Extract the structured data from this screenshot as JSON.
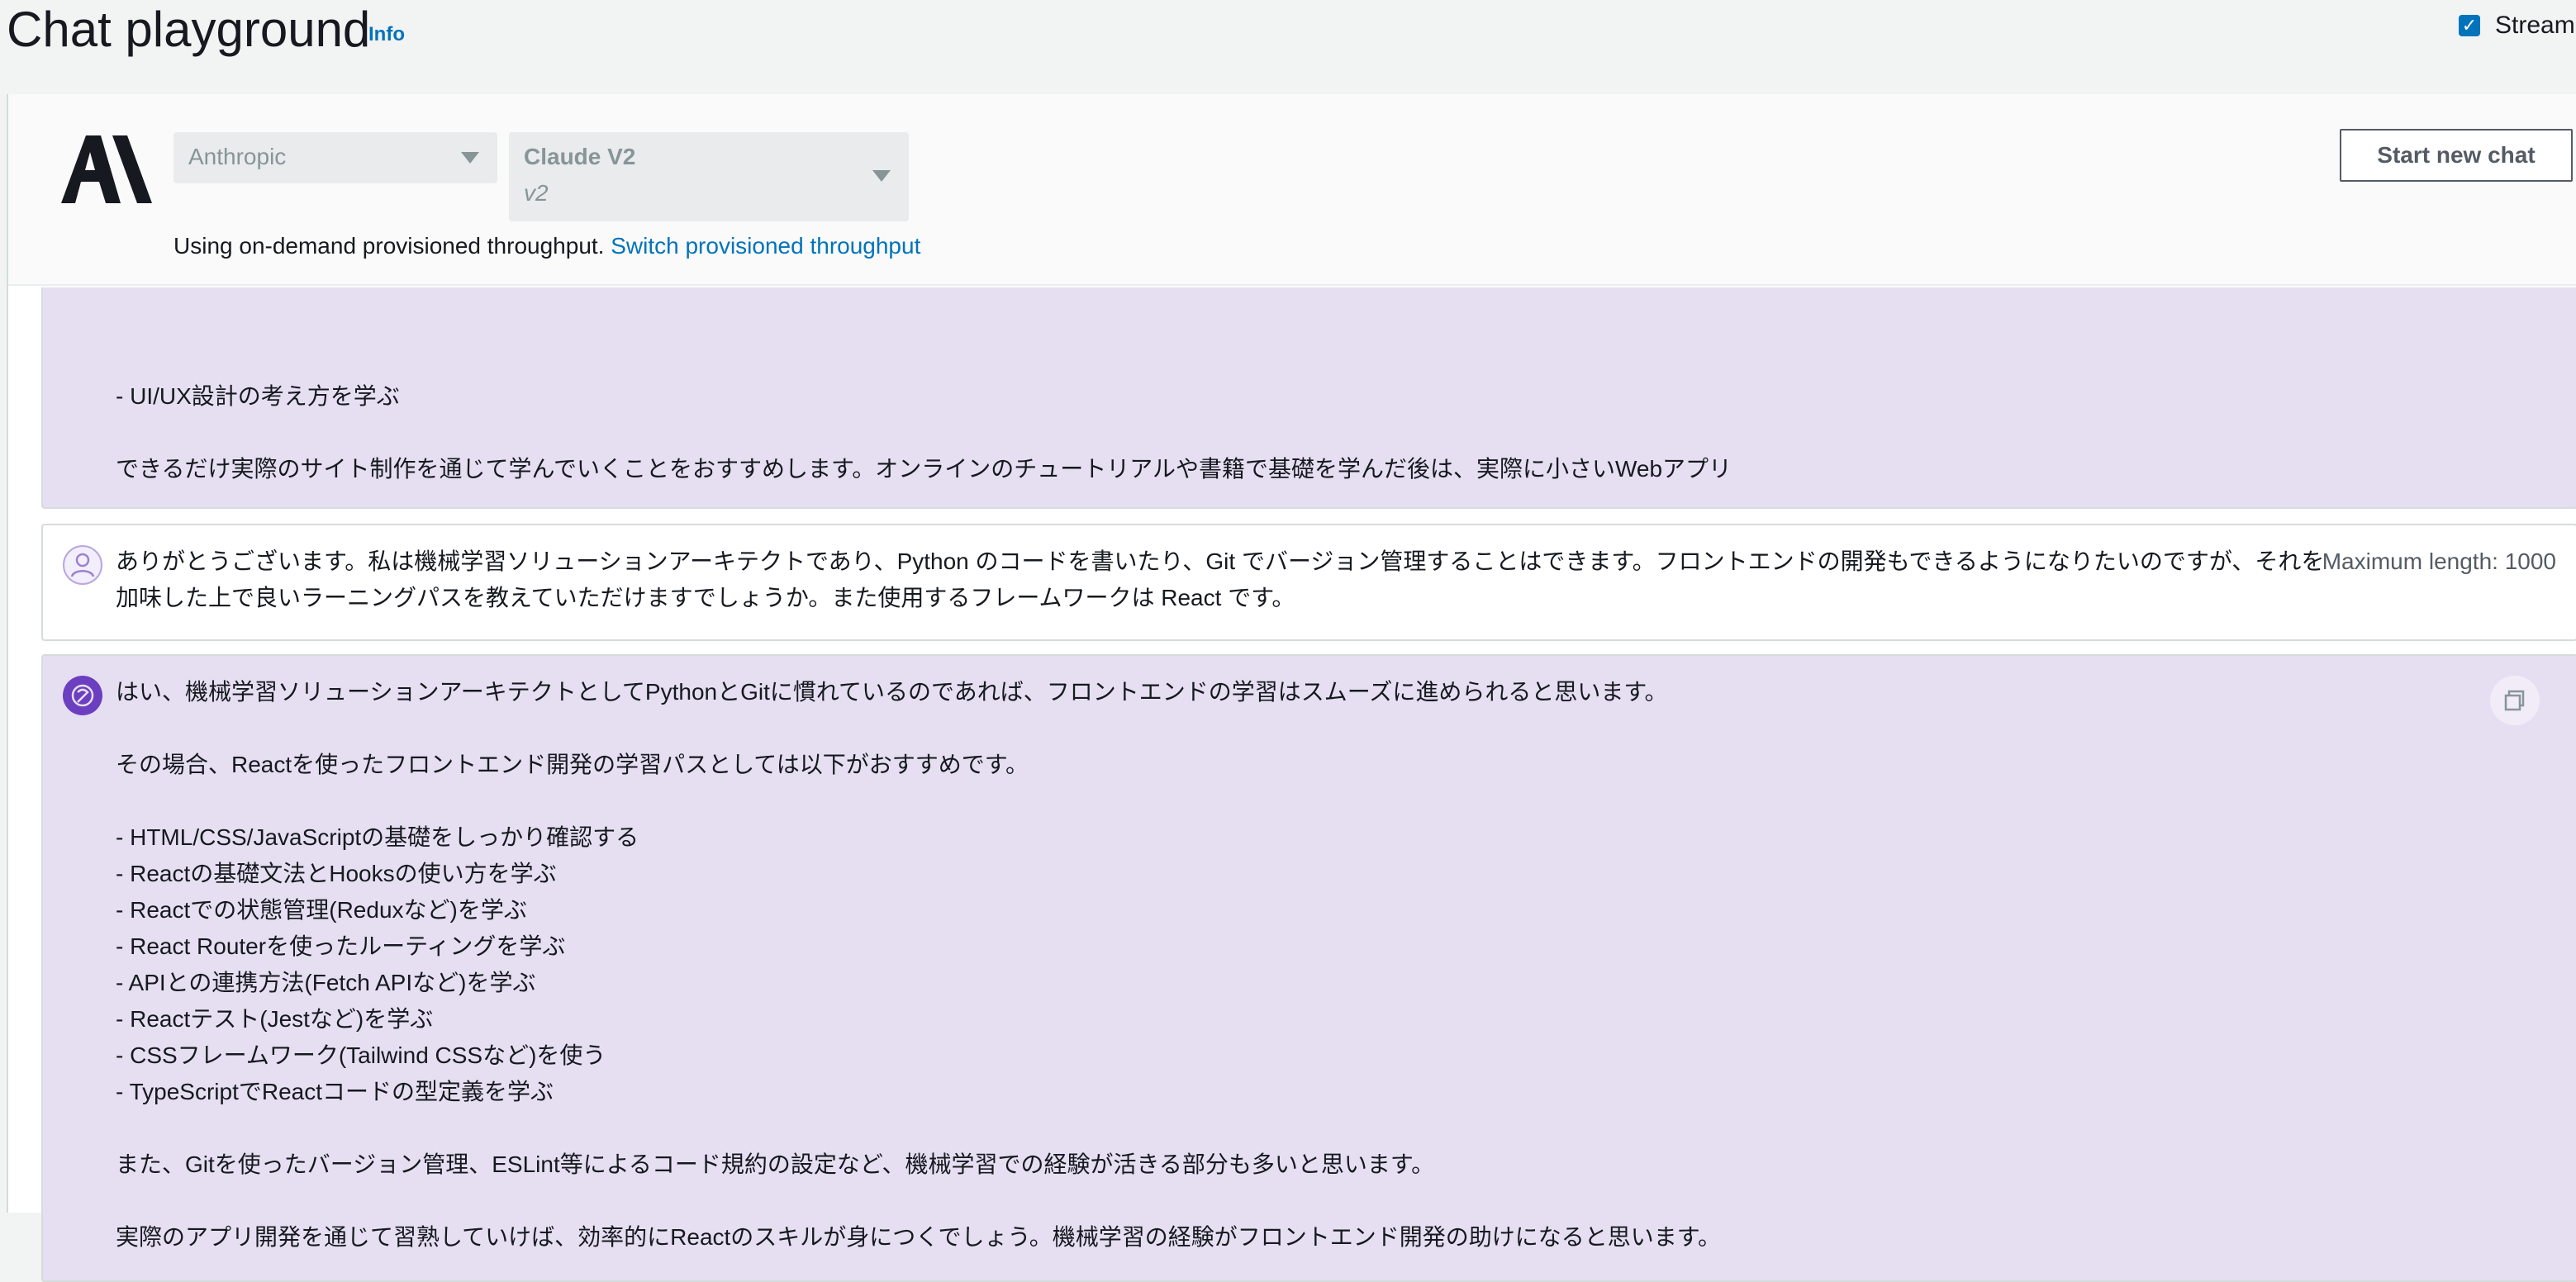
{
  "header": {
    "title": "Chat playground",
    "info": "Info",
    "streaming_label": "Streaming",
    "streaming_checked": true
  },
  "model_selector": {
    "provider": "Anthropic",
    "model": "Claude V2",
    "version": "v2",
    "throughput_text": "Using on-demand provisioned throughput.",
    "throughput_link": "Switch provisioned throughput",
    "new_chat": "Start new chat"
  },
  "messages": [
    {
      "role": "assistant",
      "lines": [
        "- UI/UX設計の考え方を学ぶ",
        "",
        "できるだけ実際のサイト制作を通じて学んでいくことをおすすめします。オンラインのチュートリアルや書籍で基礎を学んだ後は、実際に小さいWebアプリ"
      ]
    },
    {
      "role": "user",
      "text": "ありがとうございます。私は機械学習ソリューションアーキテクトであり、Python のコードを書いたり、Git でバージョン管理することはできます。フロントエンドの開発もできるようになりたいのですが、それを加味した上で良いラーニングパスを教えていただけますでしょうか。また使用するフレームワークは React です。",
      "max_length": "Maximum length: 1000"
    },
    {
      "role": "assistant",
      "lines": [
        "はい、機械学習ソリューションアーキテクトとしてPythonとGitに慣れているのであれば、フロントエンドの学習はスムーズに進められると思います。",
        "",
        "その場合、Reactを使ったフロントエンド開発の学習パスとしては以下がおすすめです。",
        "",
        "- HTML/CSS/JavaScriptの基礎をしっかり確認する",
        "- Reactの基礎文法とHooksの使い方を学ぶ",
        "- Reactでの状態管理(Reduxなど)を学ぶ",
        "- React Routerを使ったルーティングを学ぶ",
        "- APIとの連携方法(Fetch APIなど)を学ぶ",
        "- Reactテスト(Jestなど)を学ぶ",
        "- CSSフレームワーク(Tailwind CSSなど)を使う",
        "- TypeScriptでReactコードの型定義を学ぶ",
        "",
        "また、Gitを使ったバージョン管理、ESLint等によるコード規約の設定など、機械学習での経験が活きる部分も多いと思います。",
        "",
        "実際のアプリ開発を通じて習熟していけば、効率的にReactのスキルが身につくでしょう。機械学習の経験がフロントエンド開発の助けになると思います。"
      ]
    }
  ]
}
